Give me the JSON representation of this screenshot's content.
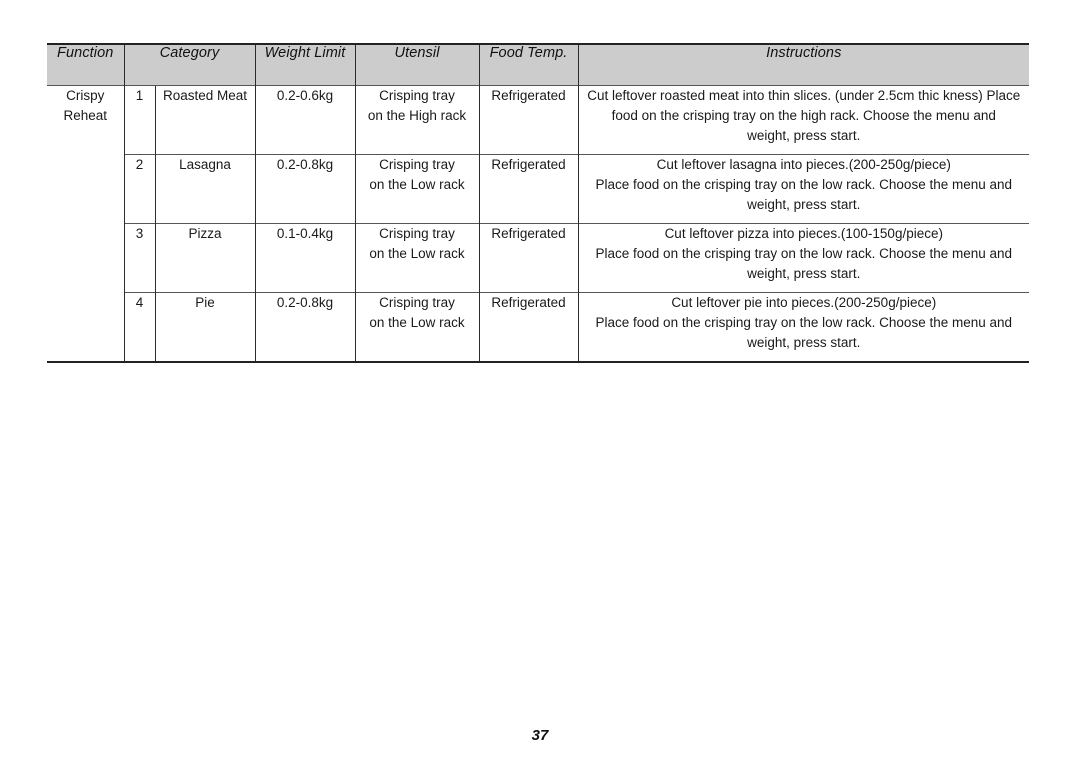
{
  "page": {
    "number": "37",
    "header_bg": "#cccccc",
    "border_color": "#2b2b2b",
    "text_color": "#1a1a1a"
  },
  "table": {
    "headers": {
      "function": "Function",
      "category": "Category",
      "weight_limit": "Weight Limit",
      "utensil": "Utensil",
      "food_temp": "Food Temp.",
      "instructions": "Instructions"
    },
    "function_label_line1": "Crispy",
    "function_label_line2": "Reheat",
    "rows": [
      {
        "index": "1",
        "category": "Roasted Meat",
        "weight_limit": "0.2-0.6kg",
        "utensil_line1": "Crisping tray",
        "utensil_line2": "on the High rack",
        "food_temp": "Refrigerated",
        "instructions_line1": "Cut leftover roasted meat into thin slices. (under 2.5cm thic kness) Place",
        "instructions_line2": "food on the crisping tray on the high rack. Choose the menu and",
        "instructions_line3": "weight, press start."
      },
      {
        "index": "2",
        "category": "Lasagna",
        "weight_limit": "0.2-0.8kg",
        "utensil_line1": "Crisping tray",
        "utensil_line2": "on the Low rack",
        "food_temp": "Refrigerated",
        "instructions_line1": "Cut leftover lasagna into pieces.(200-250g/piece)",
        "instructions_line2": "Place food on the crisping tray on the low rack. Choose the menu and",
        "instructions_line3": "weight, press start."
      },
      {
        "index": "3",
        "category": "Pizza",
        "weight_limit": "0.1-0.4kg",
        "utensil_line1": "Crisping tray",
        "utensil_line2": "on the Low rack",
        "food_temp": "Refrigerated",
        "instructions_line1": "Cut leftover pizza into pieces.(100-150g/piece)",
        "instructions_line2": "Place food on the crisping tray on the low rack. Choose the menu and",
        "instructions_line3": "weight, press start."
      },
      {
        "index": "4",
        "category": "Pie",
        "weight_limit": "0.2-0.8kg",
        "utensil_line1": "Crisping tray",
        "utensil_line2": "on the Low rack",
        "food_temp": "Refrigerated",
        "instructions_line1": "Cut leftover pie into pieces.(200-250g/piece)",
        "instructions_line2": "Place food on the crisping tray on the low rack. Choose the menu and",
        "instructions_line3": "weight, press start."
      }
    ]
  }
}
